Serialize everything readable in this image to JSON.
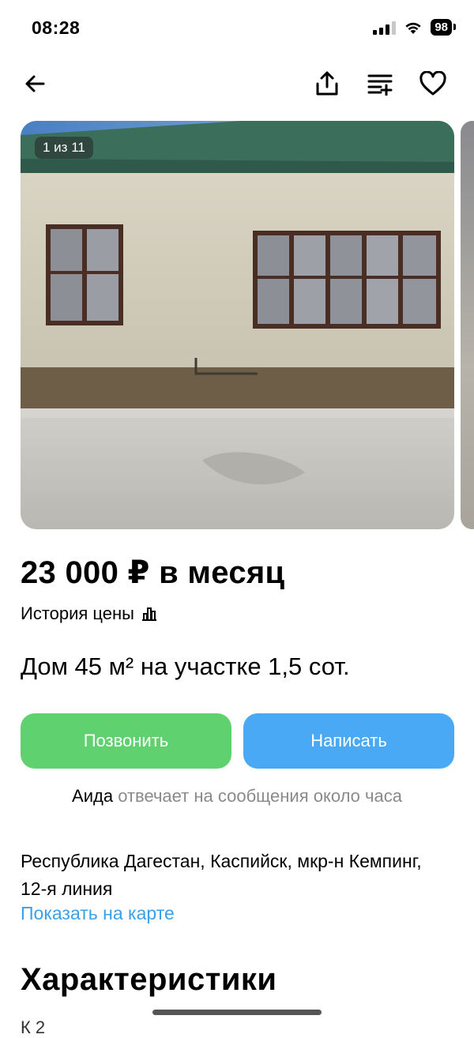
{
  "status_bar": {
    "time": "08:28",
    "battery": "98"
  },
  "nav": {
    "icons": [
      "back-arrow-icon",
      "share-icon",
      "notes-icon",
      "heart-icon"
    ]
  },
  "gallery": {
    "counter": "1 из 11"
  },
  "listing": {
    "price": "23 000 ₽ в месяц",
    "price_history_label": "История цены",
    "title": "Дом 45 м² на участке 1,5 сот."
  },
  "actions": {
    "call_label": "Позвонить",
    "write_label": "Написать"
  },
  "seller": {
    "name": "Аида",
    "reply_note": " отвечает на сообщения около часа"
  },
  "location": {
    "address": "Республика Дагестан, Каспийск, мкр-н Кемпинг, 12-я линия",
    "map_link": "Показать на карте"
  },
  "characteristics": {
    "title": "Характеристики",
    "first_row_partial": "К                                      2"
  },
  "colors": {
    "call_button": "#5fd16e",
    "write_button": "#4aa9f4",
    "link": "#3aa0ea",
    "secondary_text": "#8a8a8e"
  }
}
